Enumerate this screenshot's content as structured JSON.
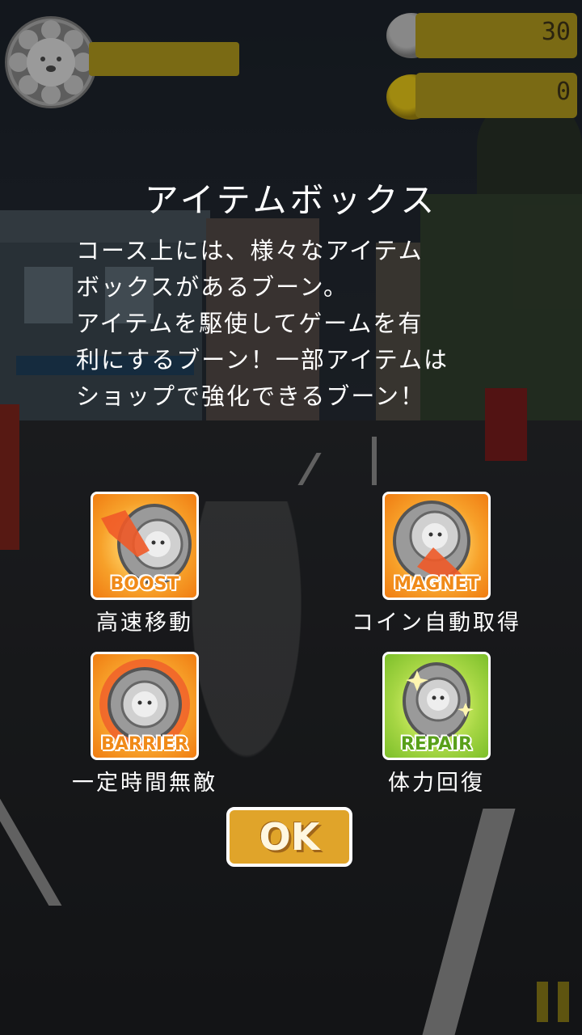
{
  "hud": {
    "coins_total": "30",
    "coins_collected": "0",
    "portrait_icon": "lion-face-icon",
    "coin_icon": "coin-icon",
    "pause_icon": "pause-icon"
  },
  "dialog": {
    "title": "アイテムボックス",
    "description_lines": [
      "コース上には、様々なアイテム",
      "ボックスがあるブーン。",
      "アイテムを駆使してゲームを有",
      "利にするブーン！一部アイテムは",
      "ショップで強化できるブーン！"
    ],
    "items": [
      {
        "tag": "BOOST",
        "label": "高速移動",
        "icon": "boost-icon",
        "bg": "orange"
      },
      {
        "tag": "MAGNET",
        "label": "コイン自動取得",
        "icon": "magnet-icon",
        "bg": "orange"
      },
      {
        "tag": "BARRIER",
        "label": "一定時間無敵",
        "icon": "barrier-icon",
        "bg": "orange"
      },
      {
        "tag": "REPAIR",
        "label": "体力回復",
        "icon": "repair-icon",
        "bg": "green"
      }
    ],
    "ok_label": "OK"
  },
  "colors": {
    "ok_button": "#e0a42a",
    "orange_tag": "#f08a18",
    "green_tag": "#59a01a"
  }
}
